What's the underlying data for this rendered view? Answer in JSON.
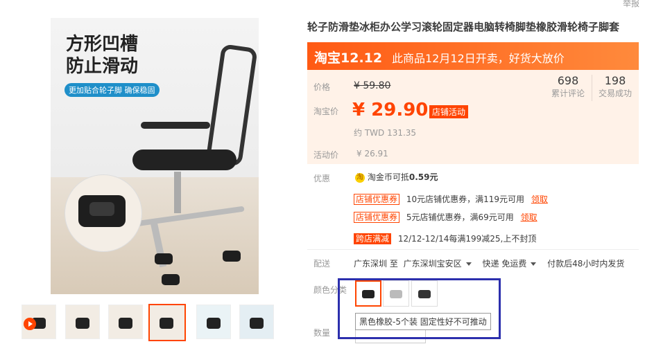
{
  "header": {
    "report_label": "举报"
  },
  "product": {
    "title": "轮子防滑垫冰柜办公学习滚轮固定器电脑转椅脚垫橡胶滑轮椅子脚套",
    "image": {
      "headline": "方形凹槽\n防止滑动",
      "pill": "更加贴合轮子脚 确保稳固"
    }
  },
  "promo": {
    "logo": "淘宝12.12",
    "text": "此商品12月12日开卖，好货大放价"
  },
  "price": {
    "orig_label": "价格",
    "orig_value": "¥ 59.80",
    "tb_label": "淘宝价",
    "tb_value": "¥ 29.90",
    "tb_tag": "店铺活动",
    "twd": "约 TWD 131.35",
    "act_label": "活动价",
    "act_value": "¥ 26.91"
  },
  "stats": [
    {
      "num": "698",
      "label": "累计评论"
    },
    {
      "num": "198",
      "label": "交易成功"
    }
  ],
  "offers": {
    "label": "优惠",
    "coin_icon": "淘",
    "coin_text": "淘金币可抵",
    "coin_value": "0.59元",
    "coupons": [
      {
        "tag": "店铺优惠券",
        "text": "10元店铺优惠券，满119元可用",
        "action": "领取"
      },
      {
        "tag": "店铺优惠券",
        "text": "5元店铺优惠券，满69元可用",
        "action": "领取"
      }
    ],
    "full_reduce": {
      "tag": "跨店满减",
      "text": "12/12-12/14每满199减25,上不封顶"
    }
  },
  "shipping": {
    "label": "配送",
    "from": "广东深圳 至",
    "to": "广东深圳宝安区",
    "method": "快递 免运费",
    "note": "付款后48小时内发货"
  },
  "sku": {
    "label": "颜色分类",
    "tooltip": "黑色橡胶-5个装 固定性好不可推动"
  },
  "qty": {
    "label": "数量"
  }
}
